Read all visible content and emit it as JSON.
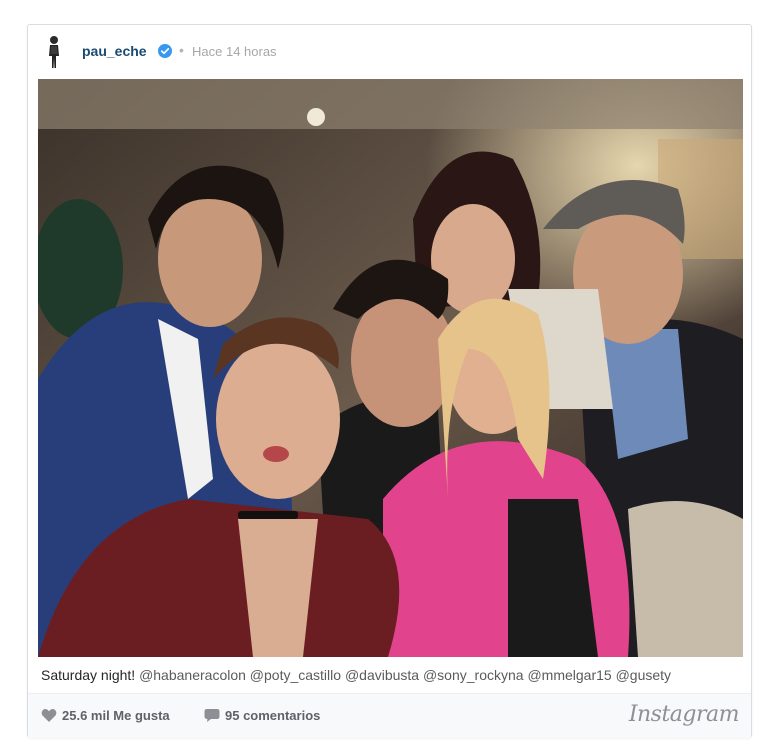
{
  "post": {
    "username": "pau_eche",
    "separator": "•",
    "timestamp": "Hace 14 horas",
    "caption_text": "Saturday night!",
    "caption_tags": "@habaneracolon @poty_castillo @davibusta @sony_rockyna @mmelgar15 @gusety",
    "likes": "25.6 mil Me gusta",
    "comments": "95 comentarios",
    "brand": "Instagram"
  },
  "icons": {
    "verified": "verified-badge-icon",
    "like": "heart-icon",
    "comment": "comment-bubble-icon"
  },
  "colors": {
    "username": "#1a4a72",
    "verified": "#3897f0",
    "muted": "#a5a7aa",
    "footer_bg": "#f8f9fa"
  }
}
